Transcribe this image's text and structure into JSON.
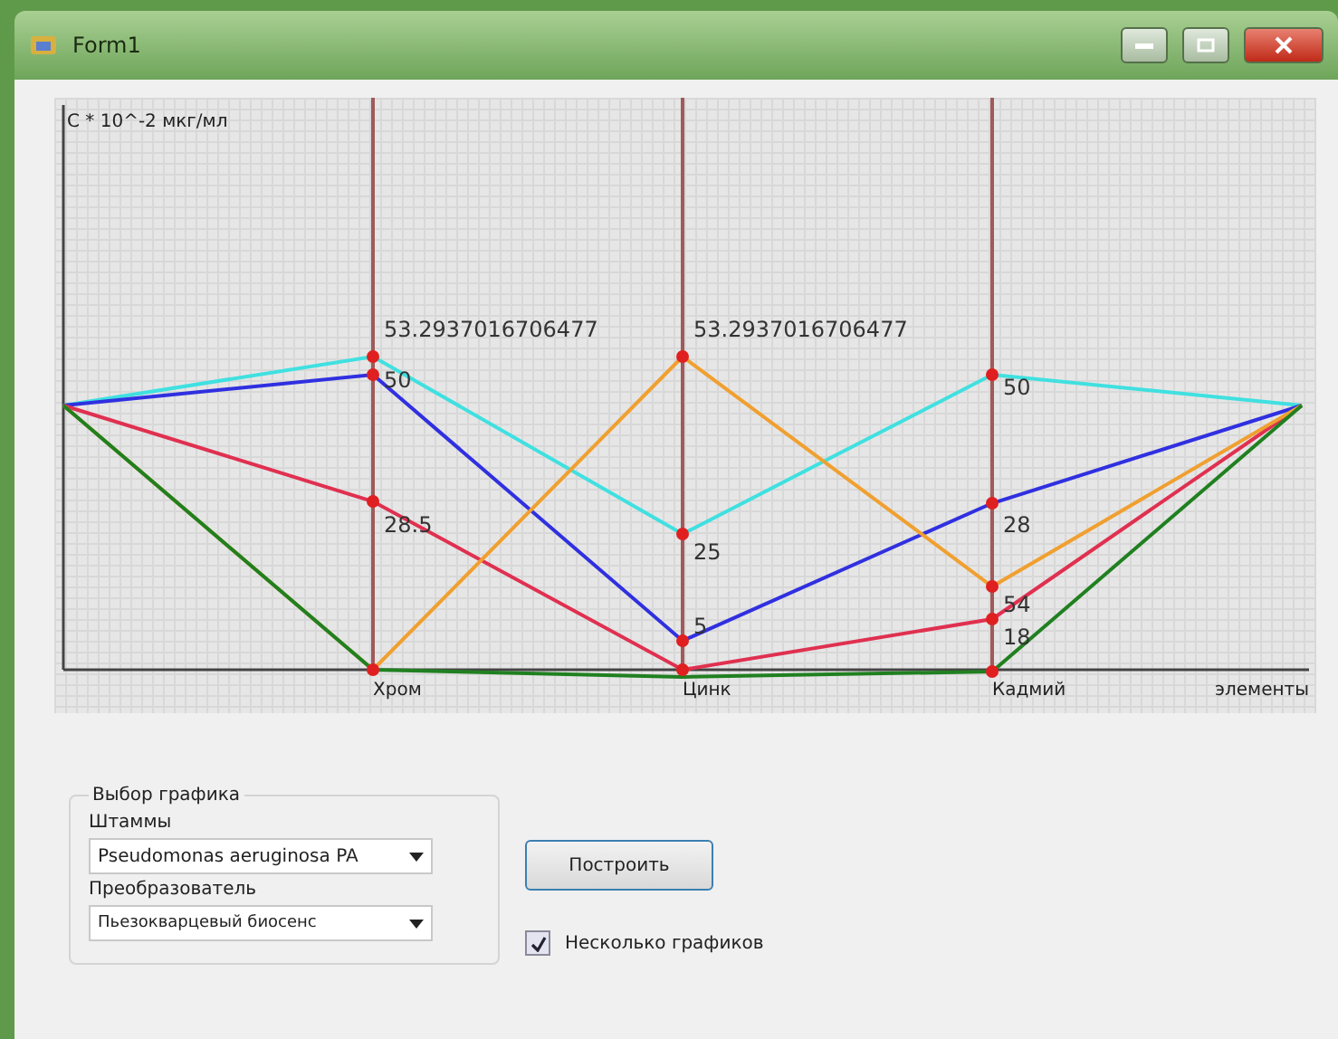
{
  "window": {
    "title": "Form1"
  },
  "chart": {
    "y_title": "C * 10^-2 мкг/мл",
    "x_title": "элементы",
    "categories": [
      "Хром",
      "Цинк",
      "Кадмий"
    ],
    "value_labels": [
      "53.2937016706477",
      "50",
      "28.5",
      "53.2937016706477",
      "25",
      "5",
      "50",
      "28",
      "54",
      "18"
    ]
  },
  "group": {
    "title": "Выбор графика",
    "strains": {
      "label": "Штаммы",
      "value": "Pseudomonas aeruginosa PA"
    },
    "converter": {
      "label": "Преобразователь",
      "value": "Пьезокварцевый биосенс"
    }
  },
  "build_button": "Построить",
  "multiple": {
    "label": "Несколько графиков",
    "checked": true
  }
}
